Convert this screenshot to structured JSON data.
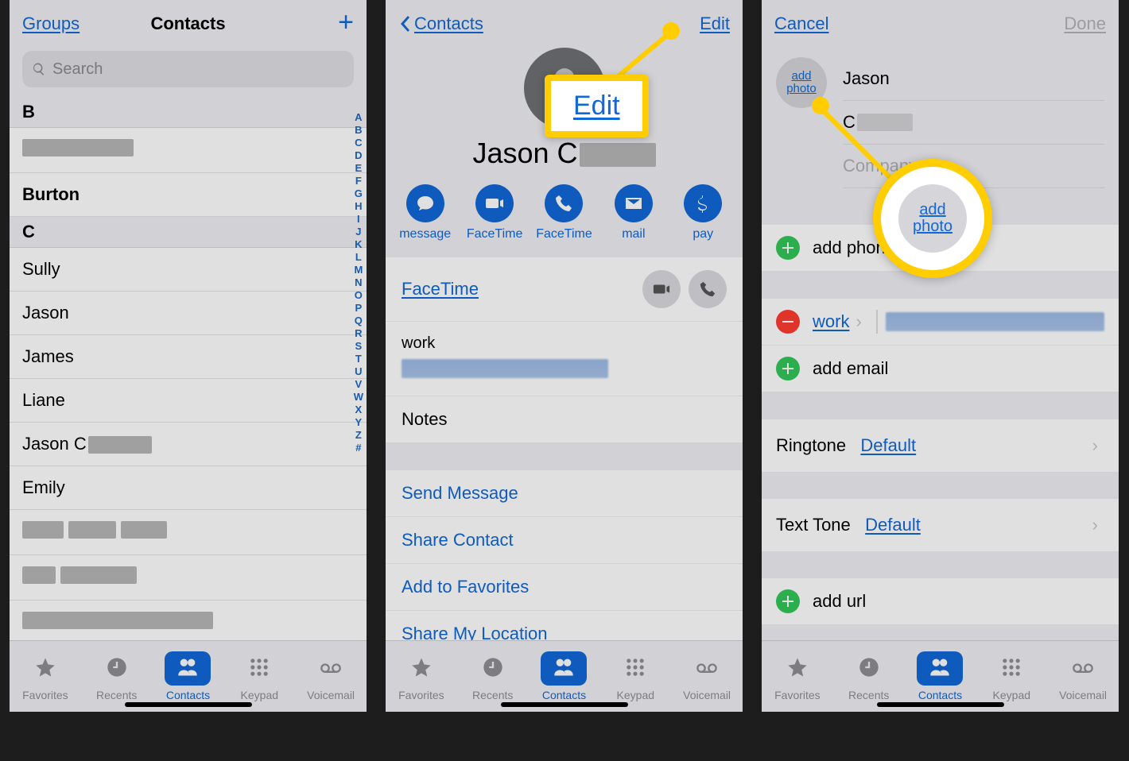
{
  "s1": {
    "groups": "Groups",
    "title": "Contacts",
    "placeholder": "Search",
    "sections": {
      "b": "B",
      "burton": "Burton",
      "c": "C"
    },
    "names": [
      "Sully",
      "Jason",
      "James",
      "Liane",
      "Jason C",
      "Emily"
    ],
    "index": [
      "A",
      "B",
      "C",
      "D",
      "E",
      "F",
      "G",
      "H",
      "I",
      "J",
      "K",
      "L",
      "M",
      "N",
      "O",
      "P",
      "Q",
      "R",
      "S",
      "T",
      "U",
      "V",
      "W",
      "X",
      "Y",
      "Z",
      "#"
    ]
  },
  "s2": {
    "back": "Contacts",
    "edit": "Edit",
    "callout": "Edit",
    "name": "Jason C",
    "actions": {
      "message": "message",
      "facetime_v": "FaceTime",
      "facetime_a": "FaceTime",
      "mail": "mail",
      "pay": "pay"
    },
    "facetime_label": "FaceTime",
    "work_label": "work",
    "notes": "Notes",
    "links": {
      "send": "Send Message",
      "share": "Share Contact",
      "fav": "Add to Favorites",
      "loc": "Share My Location"
    }
  },
  "s3": {
    "cancel": "Cancel",
    "done": "Done",
    "addphoto_l1": "add",
    "addphoto_l2": "photo",
    "first": "Jason",
    "last": "C",
    "company": "Company",
    "addphone": "add phone",
    "work": "work",
    "addemail": "add email",
    "ringtone_label": "Ringtone",
    "ringtone_value": "Default",
    "texttone_label": "Text Tone",
    "texttone_value": "Default",
    "addurl": "add url"
  },
  "tabs": {
    "favorites": "Favorites",
    "recents": "Recents",
    "contacts": "Contacts",
    "keypad": "Keypad",
    "voicemail": "Voicemail"
  }
}
